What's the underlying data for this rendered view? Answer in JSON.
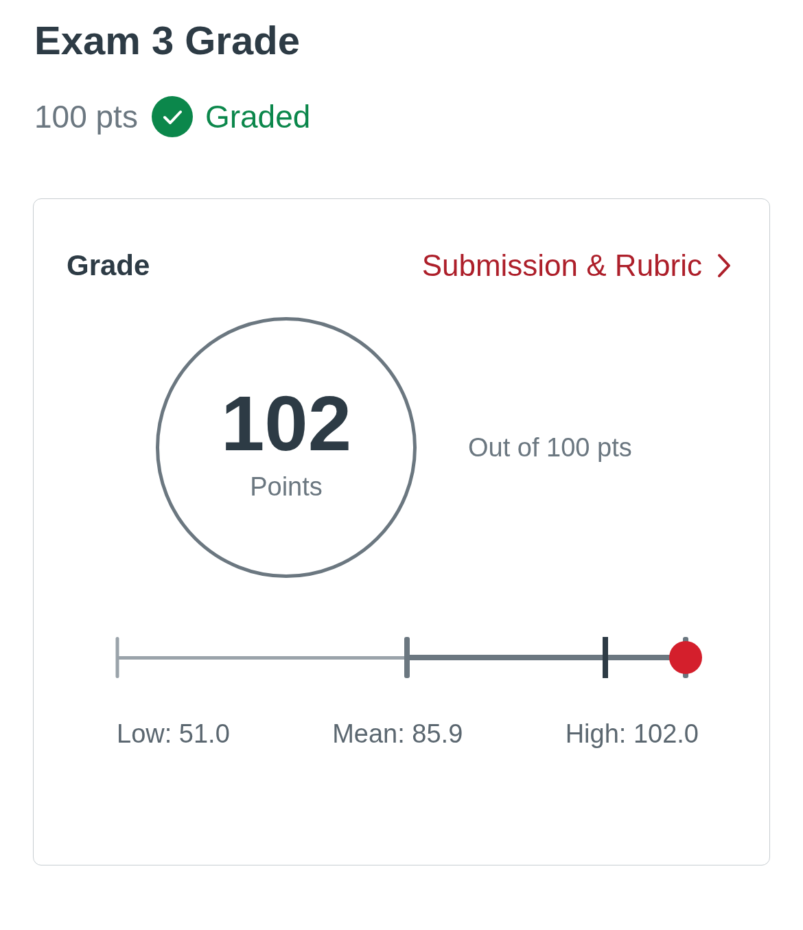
{
  "title": "Exam 3 Grade",
  "meta": {
    "points": "100 pts",
    "status": {
      "kind": "graded",
      "label": "Graded"
    }
  },
  "grade_card": {
    "heading": "Grade",
    "link": {
      "label": "Submission & Rubric"
    },
    "score": {
      "value": "102",
      "unit": "Points"
    },
    "out_of": "Out of 100 pts",
    "score_marker": {
      "level": 1
    },
    "stats": [
      "Low: 51.0",
      "Mean: 85.9",
      "High: 102.0"
    ]
  }
}
